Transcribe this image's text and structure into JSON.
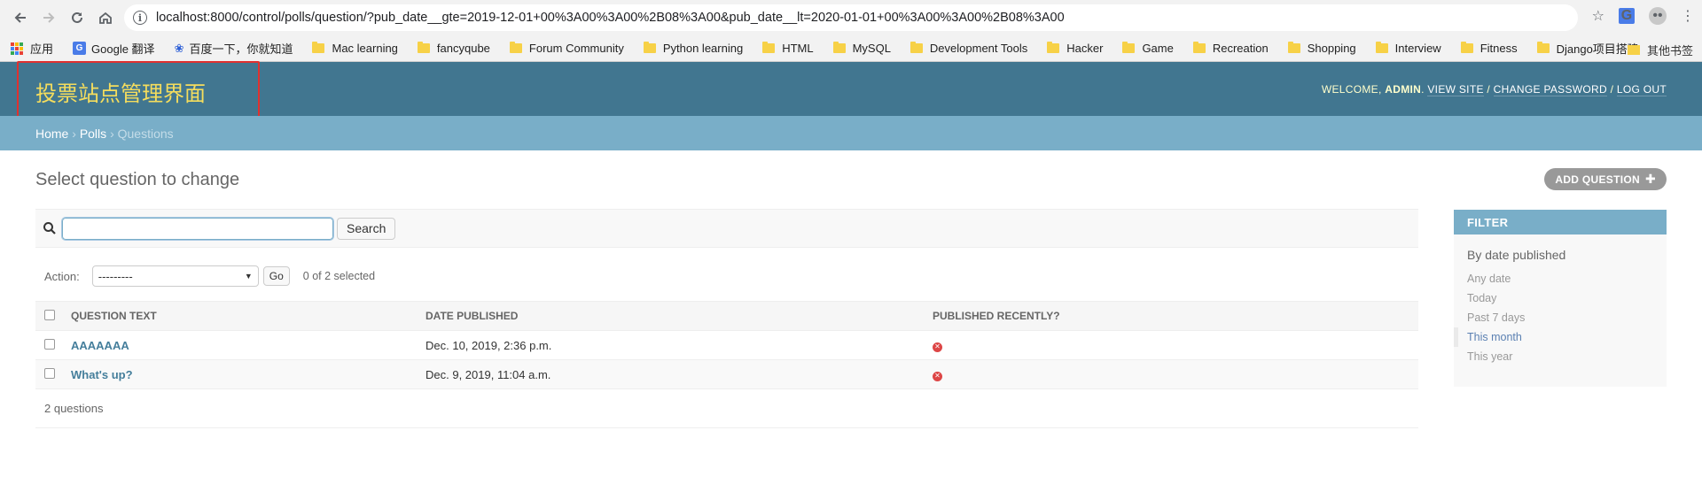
{
  "browser": {
    "url": "localhost:8000/control/polls/question/?pub_date__gte=2019-12-01+00%3A00%3A00%2B08%3A00&pub_date__lt=2020-01-01+00%3A00%3A00%2B08%3A00",
    "bookmarks": [
      "Mac learning",
      "fancyqube",
      "Forum Community",
      "Python learning",
      "HTML",
      "MySQL",
      "Development Tools",
      "Hacker",
      "Game",
      "Recreation",
      "Shopping",
      "Interview",
      "Fitness",
      "Django项目搭建"
    ],
    "apps_label": "应用",
    "google_translate": "Google 翻译",
    "baidu": "百度一下，你就知道",
    "other_bookmarks": "其他书签"
  },
  "header": {
    "site_title": "投票站点管理界面",
    "welcome": "WELCOME,",
    "user": "ADMIN",
    "view_site": "VIEW SITE",
    "change_password": "CHANGE PASSWORD",
    "log_out": "LOG OUT",
    "sep": "/"
  },
  "breadcrumbs": {
    "home": "Home",
    "polls": "Polls",
    "current": "Questions",
    "sep": "›"
  },
  "content": {
    "title": "Select question to change",
    "add_button": "ADD QUESTION",
    "search": {
      "value": "",
      "button": "Search"
    },
    "action": {
      "label": "Action:",
      "selected": "---------",
      "go": "Go",
      "count": "0 of 2 selected"
    },
    "columns": [
      "QUESTION TEXT",
      "DATE PUBLISHED",
      "PUBLISHED RECENTLY?"
    ],
    "rows": [
      {
        "text": "AAAAAAA",
        "date": "Dec. 10, 2019, 2:36 p.m.",
        "recent": "false"
      },
      {
        "text": "What's up?",
        "date": "Dec. 9, 2019, 11:04 a.m.",
        "recent": "false"
      }
    ],
    "paginator": "2 questions"
  },
  "filter": {
    "title": "FILTER",
    "by": "By date published",
    "options": [
      "Any date",
      "Today",
      "Past 7 days",
      "This month",
      "This year"
    ],
    "selected": "This month"
  },
  "colors": {
    "header": "#417690",
    "breadcrumbs": "#79aec8",
    "branding": "#f5dd5d",
    "link": "#447e9b",
    "highlight": "#e0312f"
  }
}
